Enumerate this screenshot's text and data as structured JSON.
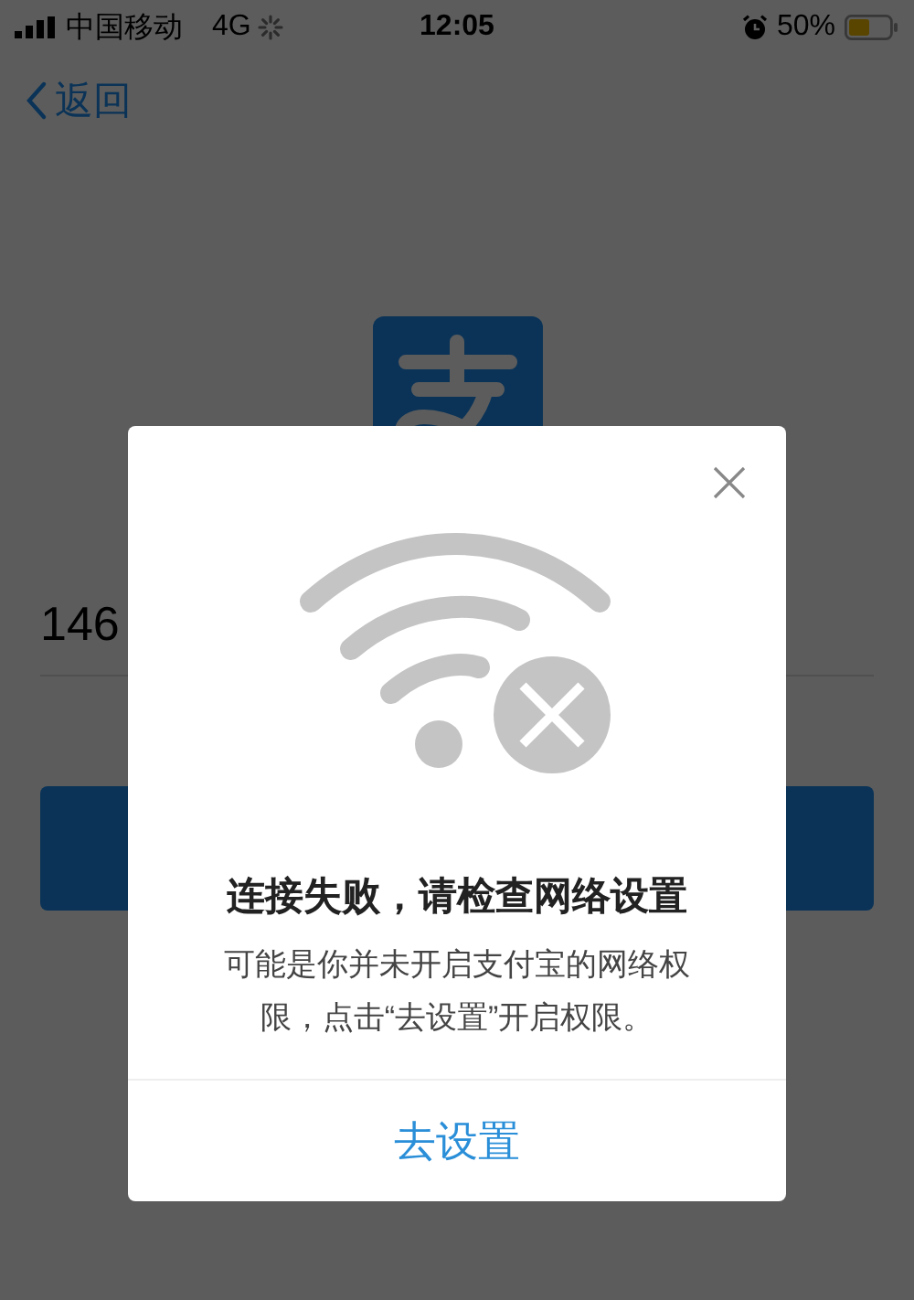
{
  "status_bar": {
    "carrier": "中国移动",
    "network": "4G",
    "time": "12:05",
    "battery": "50%"
  },
  "nav": {
    "back": "返回"
  },
  "login": {
    "account_value": "146"
  },
  "dialog": {
    "title": "连接失败，请检查网络设置",
    "message": "可能是你并未开启支付宝的网络权限，点击“去设置”开启权限。",
    "action": "去设置"
  }
}
